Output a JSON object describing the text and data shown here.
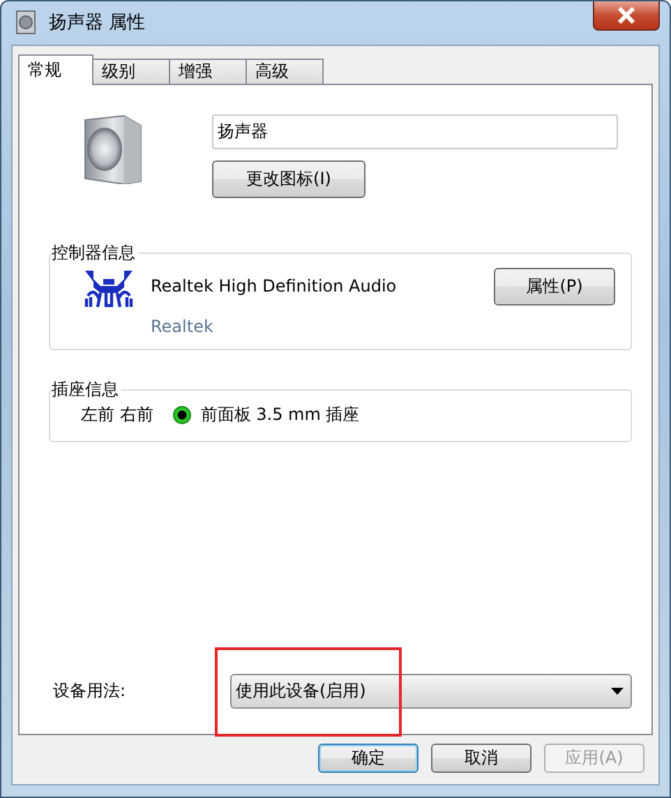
{
  "window": {
    "title": "扬声器 属性"
  },
  "tabs": [
    {
      "label": "常规",
      "selected": true
    },
    {
      "label": "级别",
      "selected": false
    },
    {
      "label": "增强",
      "selected": false
    },
    {
      "label": "高级",
      "selected": false
    }
  ],
  "device": {
    "name": "扬声器",
    "change_icon_button": "更改图标(I)"
  },
  "controller": {
    "heading": "控制器信息",
    "name": "Realtek High Definition Audio",
    "vendor": "Realtek",
    "properties_button": "属性(P)"
  },
  "jack": {
    "heading": "插座信息",
    "channels": "左前 右前",
    "location": "前面板 3.5 mm 插座"
  },
  "usage": {
    "label": "设备用法:",
    "value": "使用此设备(启用)"
  },
  "buttons": [
    {
      "label": "确定",
      "kind": "default",
      "disabled": false
    },
    {
      "label": "取消",
      "kind": "normal",
      "disabled": false
    },
    {
      "label": "应用(A)",
      "kind": "normal",
      "disabled": true
    }
  ]
}
